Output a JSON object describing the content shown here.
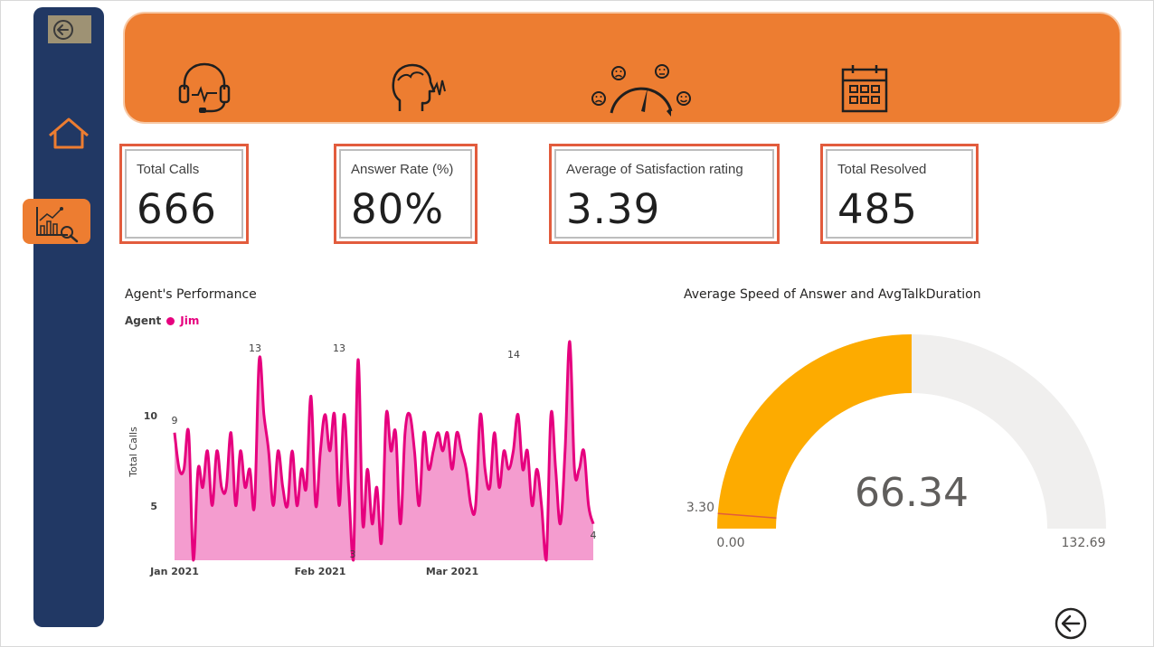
{
  "nav": {
    "back_top_icon": "back-arrow-icon",
    "home_icon": "home-icon",
    "report_icon": "report-analytics-icon",
    "back_bottom_icon": "back-arrow-icon"
  },
  "banner": {
    "icons": [
      "headset-agent-icon",
      "speaking-head-icon",
      "satisfaction-gauge-icon",
      "calendar-icon"
    ],
    "color": "#ed7d31"
  },
  "kpis": [
    {
      "label": "Total Calls",
      "value": "666"
    },
    {
      "label": "Answer Rate (%)",
      "value": "80%"
    },
    {
      "label": "Average of Satisfaction rating",
      "value": "3.39"
    },
    {
      "label": "Total Resolved",
      "value": "485"
    }
  ],
  "agent_chart": {
    "title": "Agent's Performance",
    "legend_label": "Agent",
    "legend_series": "Jim",
    "series_color": "#e6007e",
    "fill_color": "#f49ccf",
    "ylabel": "Total Calls",
    "yticks": [
      "10",
      "5"
    ],
    "xticks": [
      "Jan 2021",
      "Feb 2021",
      "Mar 2021"
    ],
    "data_labels": [
      "9",
      "13",
      "13",
      "14",
      "3",
      "4"
    ]
  },
  "gauge": {
    "title": "Average Speed of Answer and AvgTalkDuration",
    "value_label": "66.34",
    "min_label": "0.00",
    "max_label": "132.69",
    "target_label": "3.30",
    "fill_color": "#fdab00",
    "track_color": "#f0efee"
  },
  "chart_data": [
    {
      "type": "area",
      "title": "Agent's Performance",
      "xlabel": "",
      "ylabel": "Total Calls",
      "legend": "top-left",
      "x": [
        "2021-01-01",
        "2021-01-02",
        "2021-01-03",
        "2021-01-04",
        "2021-01-05",
        "2021-01-06",
        "2021-01-07",
        "2021-01-08",
        "2021-01-09",
        "2021-01-10",
        "2021-01-11",
        "2021-01-12",
        "2021-01-13",
        "2021-01-14",
        "2021-01-15",
        "2021-01-16",
        "2021-01-17",
        "2021-01-18",
        "2021-01-19",
        "2021-01-20",
        "2021-01-21",
        "2021-01-22",
        "2021-01-23",
        "2021-01-24",
        "2021-01-25",
        "2021-01-26",
        "2021-01-27",
        "2021-01-28",
        "2021-01-29",
        "2021-01-30",
        "2021-01-31",
        "2021-02-01",
        "2021-02-02",
        "2021-02-03",
        "2021-02-04",
        "2021-02-05",
        "2021-02-06",
        "2021-02-07",
        "2021-02-08",
        "2021-02-09",
        "2021-02-10",
        "2021-02-11",
        "2021-02-12",
        "2021-02-13",
        "2021-02-14",
        "2021-02-15",
        "2021-02-16",
        "2021-02-17",
        "2021-02-18",
        "2021-02-19",
        "2021-02-20",
        "2021-02-21",
        "2021-02-22",
        "2021-02-23",
        "2021-02-24",
        "2021-02-25",
        "2021-02-26",
        "2021-02-27",
        "2021-02-28",
        "2021-03-01",
        "2021-03-02",
        "2021-03-03",
        "2021-03-04",
        "2021-03-05",
        "2021-03-06",
        "2021-03-07",
        "2021-03-08",
        "2021-03-09",
        "2021-03-10",
        "2021-03-11",
        "2021-03-12",
        "2021-03-13",
        "2021-03-14",
        "2021-03-15",
        "2021-03-16",
        "2021-03-17",
        "2021-03-18",
        "2021-03-19",
        "2021-03-20",
        "2021-03-21",
        "2021-03-22",
        "2021-03-23",
        "2021-03-24",
        "2021-03-25",
        "2021-03-26",
        "2021-03-27",
        "2021-03-28",
        "2021-03-29",
        "2021-03-30",
        "2021-03-31"
      ],
      "series": [
        {
          "name": "Jim",
          "values": [
            9,
            7,
            7,
            9,
            2,
            7,
            6,
            8,
            5,
            8,
            6,
            6,
            9,
            5,
            8,
            6,
            7,
            5,
            13,
            10,
            8,
            5,
            8,
            6,
            5,
            8,
            5,
            7,
            6,
            11,
            5,
            8,
            10,
            8,
            10,
            5,
            10,
            6,
            2,
            13,
            4,
            7,
            4,
            6,
            3,
            10,
            8,
            9,
            4,
            9,
            10,
            8,
            5,
            9,
            7,
            8,
            9,
            8,
            9,
            7,
            9,
            8,
            7,
            5,
            5,
            10,
            7,
            6,
            9,
            6,
            8,
            7,
            8,
            10,
            7,
            8,
            5,
            7,
            5,
            2,
            10,
            7,
            4,
            8,
            14,
            7,
            7,
            8,
            5,
            4
          ]
        }
      ],
      "point_labels": [
        {
          "x": "2021-01-01",
          "label": "9"
        },
        {
          "x": "2021-01-19",
          "label": "13"
        },
        {
          "x": "2021-02-09",
          "label": "13"
        },
        {
          "x": "2021-02-14",
          "label": "3"
        },
        {
          "x": "2021-03-25",
          "label": "14"
        },
        {
          "x": "2021-03-31",
          "label": "4"
        }
      ],
      "ylim": [
        2,
        14
      ]
    },
    {
      "type": "gauge",
      "title": "Average Speed of Answer and AvgTalkDuration",
      "value": 66.34,
      "min": 0.0,
      "max": 132.69,
      "target": 3.3
    }
  ]
}
